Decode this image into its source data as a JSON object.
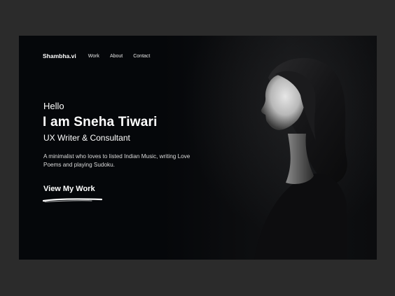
{
  "nav": {
    "brand": "Shambha.vi",
    "links": [
      "Work",
      "About",
      "Contact"
    ]
  },
  "hero": {
    "greeting": "Hello",
    "headline": "I am Sneha Tiwari",
    "role": "UX Writer & Consultant",
    "description": "A minimalist who loves to listed Indian Music, writing Love Poems and playing Sudoku.",
    "cta_label": "View My Work"
  },
  "colors": {
    "background": "#05070a",
    "outer": "#2b2b2b",
    "text": "#ffffff"
  },
  "icons": {
    "cta_underline": "brush-stroke"
  }
}
